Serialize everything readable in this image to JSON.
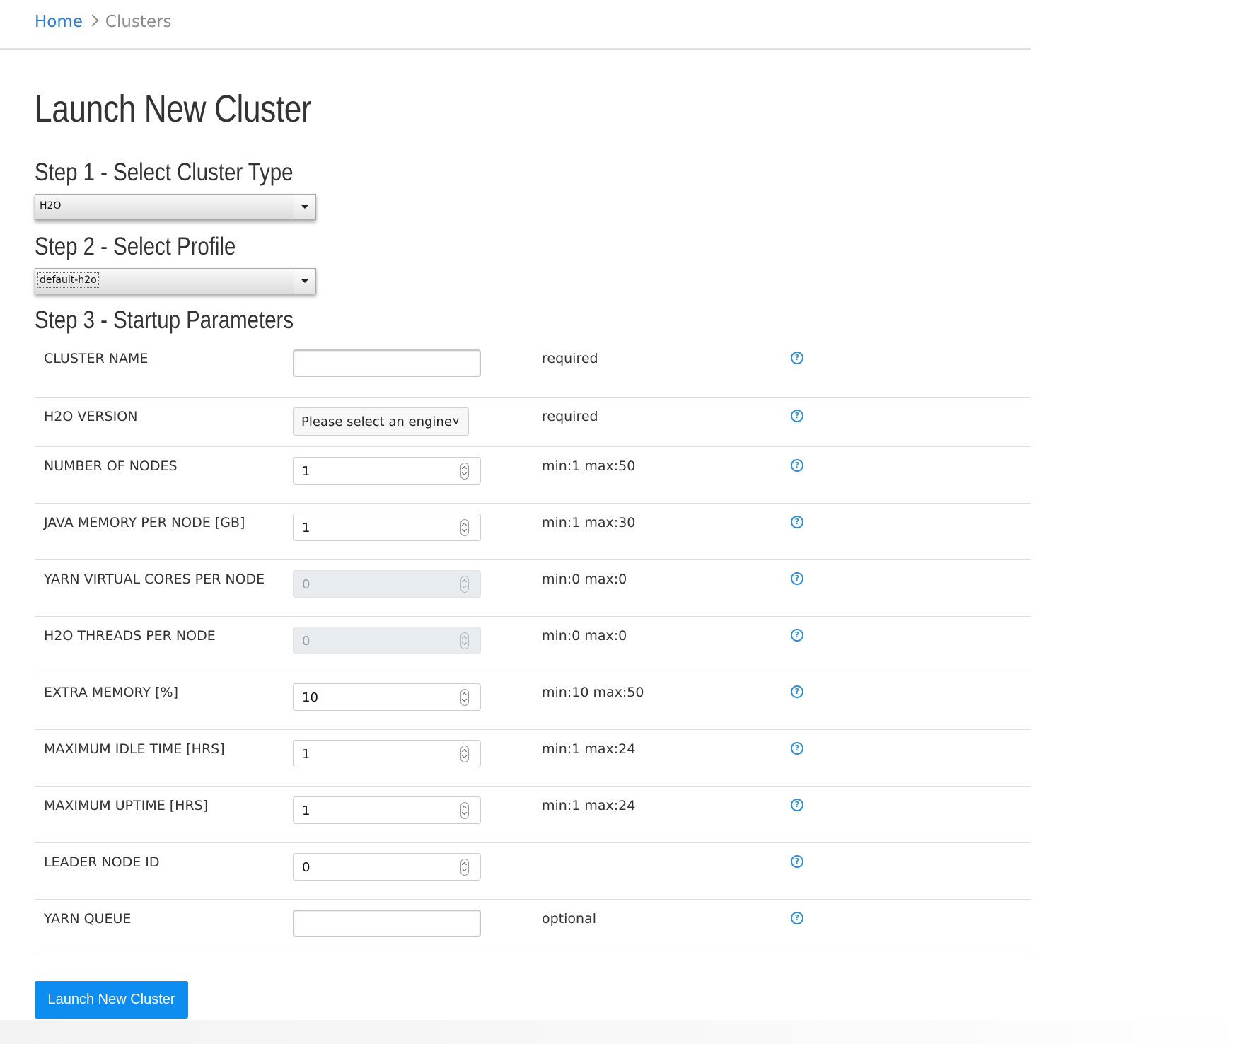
{
  "breadcrumb": {
    "home": "Home",
    "current": "Clusters"
  },
  "title": "Launch New Cluster",
  "steps": {
    "step1": "Step 1 - Select Cluster Type",
    "step2": "Step 2 - Select Profile",
    "step3": "Step 3 - Startup Parameters"
  },
  "cluster_type": {
    "selected": "H2O"
  },
  "profile": {
    "selected": "default-h2o"
  },
  "params": [
    {
      "label": "CLUSTER NAME",
      "kind": "text",
      "value": "",
      "hint": "required"
    },
    {
      "label": "H2O VERSION",
      "kind": "select",
      "value": "Please select an engine",
      "hint": "required"
    },
    {
      "label": "NUMBER OF NODES",
      "kind": "number",
      "value": "1",
      "hint": "min:1 max:50"
    },
    {
      "label": "JAVA MEMORY PER NODE [GB]",
      "kind": "number",
      "value": "1",
      "hint": "min:1 max:30"
    },
    {
      "label": "YARN VIRTUAL CORES PER NODE",
      "kind": "number",
      "value": "0",
      "hint": "min:0 max:0",
      "disabled": true
    },
    {
      "label": "H2O THREADS PER NODE",
      "kind": "number",
      "value": "0",
      "hint": "min:0 max:0",
      "disabled": true
    },
    {
      "label": "EXTRA MEMORY [%]",
      "kind": "number",
      "value": "10",
      "hint": "min:10 max:50"
    },
    {
      "label": "MAXIMUM IDLE TIME [HRS]",
      "kind": "number",
      "value": "1",
      "hint": "min:1 max:24"
    },
    {
      "label": "MAXIMUM UPTIME [HRS]",
      "kind": "number",
      "value": "1",
      "hint": "min:1 max:24"
    },
    {
      "label": "LEADER NODE ID",
      "kind": "number",
      "value": "0",
      "hint": ""
    },
    {
      "label": "YARN QUEUE",
      "kind": "text",
      "value": "",
      "hint": "optional"
    }
  ],
  "icons": {
    "help": "help-circle-icon",
    "breadcrumb_separator": "chevron-right-icon",
    "spinner": "spinner-arrows-icon"
  },
  "colors": {
    "accent": "#0d8df0",
    "link": "#2b7bd4",
    "help": "#2b8fd8"
  },
  "launch_button": "Launch New Cluster"
}
